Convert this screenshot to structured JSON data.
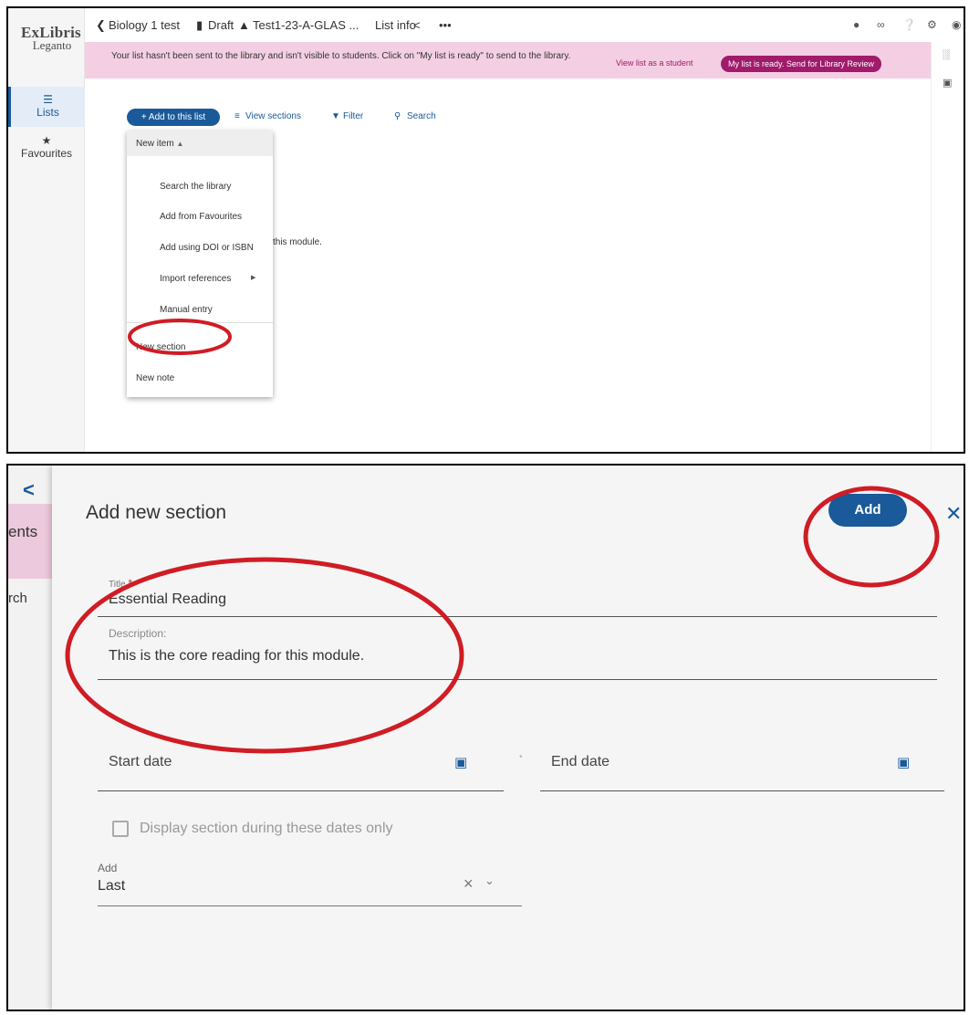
{
  "panel1": {
    "logo": {
      "line1": "ExLibris",
      "line2": "Leganto"
    },
    "nav": {
      "lists": {
        "label": "Lists",
        "icon": "list-icon"
      },
      "favourites": {
        "label": "Favourites",
        "icon": "star-icon"
      }
    },
    "topbar": {
      "list_title": "Biology 1 test",
      "status": "Draft",
      "course": "Test1-23-A-GLAS ...",
      "list_info": "List info"
    },
    "banner": {
      "message": "Your list hasn't been sent to the library and isn't visible to students. Click on \"My list is ready\" to send to the library.",
      "view_as_student": "View list as a student",
      "ready_button": "My list is ready. Send for Library Review"
    },
    "toolbar": {
      "add_to_list": "+ Add to this list",
      "view_sections": "View sections",
      "filter": "Filter",
      "search": "Search"
    },
    "menu": {
      "new_item": "New item",
      "items": [
        "Search the library",
        "Add from Favourites",
        "Add using DOI or ISBN",
        "Import references",
        "Manual entry"
      ],
      "new_section": "New section",
      "new_note": "New note"
    },
    "background_text": "this module."
  },
  "panel2": {
    "strip": {
      "partial_text_1": "ents",
      "partial_text_2": "rch"
    },
    "dialog": {
      "heading": "Add new section",
      "add_button": "Add",
      "title_label": "Title",
      "title_required_mark": "*",
      "title_value": "Essential Reading",
      "description_label": "Description:",
      "description_value": "This is the core reading for this module.",
      "start_date_placeholder": "Start date",
      "end_date_placeholder": "End date",
      "display_dates_label": "Display section during these dates only",
      "display_dates_checked": false,
      "position_label": "Add",
      "position_value": "Last"
    }
  },
  "colors": {
    "primary": "#1a5a9a",
    "brand_magenta": "#a11a6b",
    "banner_bg": "#f4cfe3",
    "annotation_red": "#d01c24"
  }
}
